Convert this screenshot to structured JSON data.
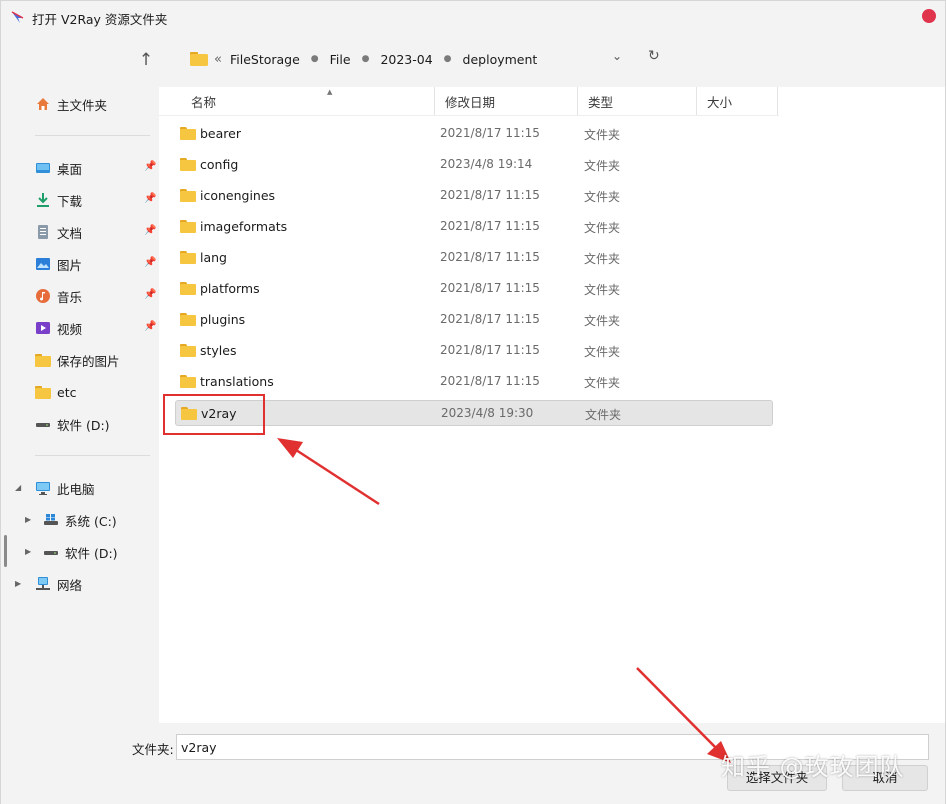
{
  "window": {
    "title": "打开 V2Ray 资源文件夹"
  },
  "breadcrumb": {
    "overflow": "«",
    "items": [
      "FileStorage",
      "File",
      "2023-04",
      "deployment"
    ]
  },
  "sidebar": {
    "home": "主文件夹",
    "quick_access": [
      "桌面",
      "下载",
      "文档",
      "图片",
      "音乐",
      "视频"
    ],
    "folders": [
      "保存的图片",
      "etc",
      "软件 (D:)"
    ],
    "this_pc": "此电脑",
    "drives": [
      "系统 (C:)",
      "软件 (D:)"
    ],
    "network": "网络"
  },
  "columns": {
    "name": "名称",
    "date": "修改日期",
    "type": "类型",
    "size": "大小"
  },
  "files": [
    {
      "name": "bearer",
      "date": "2021/8/17 11:15",
      "type": "文件夹"
    },
    {
      "name": "config",
      "date": "2023/4/8 19:14",
      "type": "文件夹"
    },
    {
      "name": "iconengines",
      "date": "2021/8/17 11:15",
      "type": "文件夹"
    },
    {
      "name": "imageformats",
      "date": "2021/8/17 11:15",
      "type": "文件夹"
    },
    {
      "name": "lang",
      "date": "2021/8/17 11:15",
      "type": "文件夹"
    },
    {
      "name": "platforms",
      "date": "2021/8/17 11:15",
      "type": "文件夹"
    },
    {
      "name": "plugins",
      "date": "2021/8/17 11:15",
      "type": "文件夹"
    },
    {
      "name": "styles",
      "date": "2021/8/17 11:15",
      "type": "文件夹"
    },
    {
      "name": "translations",
      "date": "2021/8/17 11:15",
      "type": "文件夹"
    },
    {
      "name": "v2ray",
      "date": "2023/4/8 19:30",
      "type": "文件夹"
    }
  ],
  "footer": {
    "folder_label": "文件夹:",
    "folder_value": "v2ray",
    "select_button": "选择文件夹",
    "cancel_button": "取消"
  },
  "watermark": "知乎 @玫玫团队",
  "colors": {
    "accent_red": "#e0302f",
    "close_red": "#e0334c",
    "folder_yellow": "#f7c640"
  }
}
